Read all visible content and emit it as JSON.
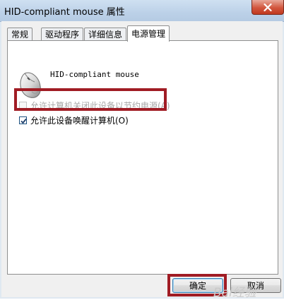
{
  "window": {
    "title": "HID-compliant mouse 属性",
    "close_icon": "close-icon"
  },
  "tabs": [
    {
      "label": "常规",
      "active": false
    },
    {
      "label": "驱动程序",
      "active": false
    },
    {
      "label": "详细信息",
      "active": false
    },
    {
      "label": "电源管理",
      "active": true
    }
  ],
  "device": {
    "name": "HID-compliant mouse",
    "icon": "mouse-icon"
  },
  "options": [
    {
      "label": "允许计算机关闭此设备以节约电源(A)",
      "checked": false,
      "enabled": false
    },
    {
      "label": "允许此设备唤醒计算机(O)",
      "checked": true,
      "enabled": true
    }
  ],
  "buttons": {
    "ok_label": "确定",
    "cancel_label": "取消"
  },
  "watermark": "Bai经验",
  "colors": {
    "highlight": "#a01c24",
    "titlebar": "#bcd1e8",
    "close": "#c0391f"
  }
}
